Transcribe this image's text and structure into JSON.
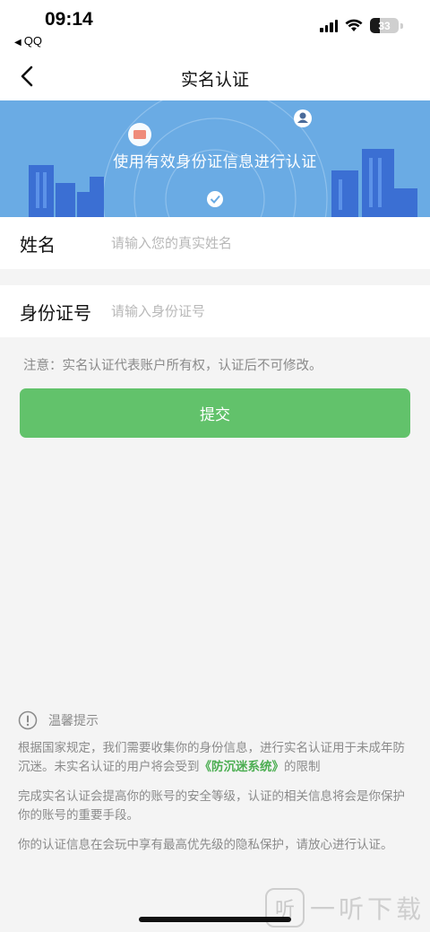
{
  "status_bar": {
    "time": "09:14",
    "back_app": "QQ",
    "battery": "33",
    "battery_level": 0.33
  },
  "nav": {
    "title": "实名认证"
  },
  "banner": {
    "text": "使用有效身份证信息进行认证",
    "color": "#6aabe4"
  },
  "form": {
    "name_label": "姓名",
    "name_placeholder": "请输入您的真实姓名",
    "name_value": "",
    "id_label": "身份证号",
    "id_placeholder": "请输入身份证号",
    "id_value": ""
  },
  "note": "注意：实名认证代表账户所有权，认证后不可修改。",
  "submit": {
    "label": "提交",
    "color": "#62c26b"
  },
  "tips": {
    "title": "温馨提示",
    "p1_before": "根据国家规定，我们需要收集你的身份信息，进行实名认证用于未成年防沉迷。未实名认证的用户将会受到",
    "p1_link": "《防沉迷系统》",
    "p1_after": "的限制",
    "p2": "完成实名认证会提高你的账号的安全等级，认证的相关信息将会是你保护你的账号的重要手段。",
    "p3": "你的认证信息在会玩中享有最高优先级的隐私保护，请放心进行认证。"
  },
  "watermark": {
    "mark": "听",
    "text": "一听下载"
  }
}
